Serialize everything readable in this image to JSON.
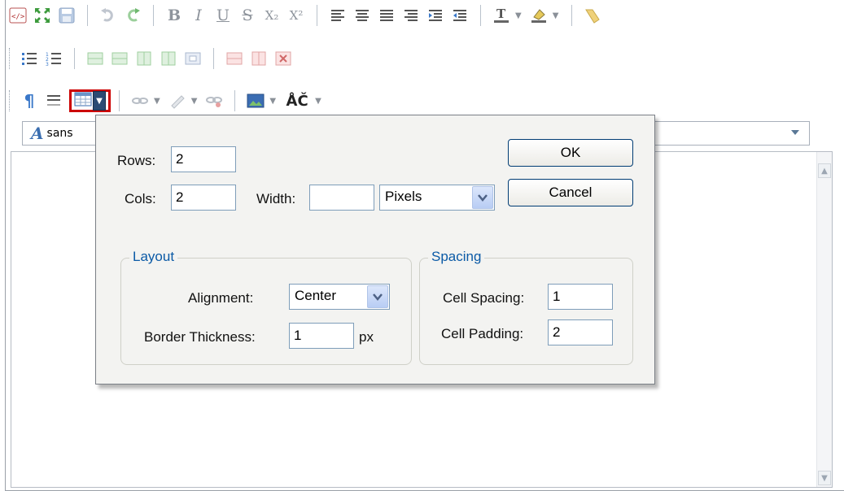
{
  "toolbar": {
    "row1": {
      "icons": [
        "html-source-icon",
        "fullscreen-icon",
        "save-icon",
        "undo-icon",
        "redo-icon"
      ],
      "bold": "B",
      "italic": "I",
      "underline": "U",
      "strike": "S",
      "subscript": "X₂",
      "superscript": "X²",
      "align_icons": [
        "align-left-icon",
        "align-center-icon",
        "align-right-icon",
        "align-justify-icon",
        "indent-icon",
        "outdent-icon"
      ],
      "text_color_icon": "text-color-icon",
      "bg_color_icon": "background-color-icon",
      "format_painter_icon": "format-painter-icon"
    },
    "row2": {
      "icons": [
        "bulleted-list-icon",
        "numbered-list-icon",
        "insert-row-above-icon",
        "insert-row-below-icon",
        "insert-col-left-icon",
        "insert-col-right-icon",
        "merge-cells-icon",
        "delete-row-icon",
        "delete-col-icon",
        "delete-table-icon"
      ]
    },
    "row3": {
      "pilcrow": "¶",
      "special_chars": "ÅČ",
      "icons": [
        "paragraph-icon",
        "horizontal-rule-icon",
        "insert-table-icon",
        "link-icon",
        "unlink-icon",
        "anchor-icon",
        "image-icon"
      ]
    },
    "font_name": "sans"
  },
  "dialog": {
    "rows_label": "Rows:",
    "rows_value": "2",
    "cols_label": "Cols:",
    "cols_value": "2",
    "width_label": "Width:",
    "width_value": "",
    "width_unit": "Pixels",
    "ok_label": "OK",
    "cancel_label": "Cancel",
    "layout": {
      "legend": "Layout",
      "alignment_label": "Alignment:",
      "alignment_value": "Center",
      "border_label": "Border Thickness:",
      "border_value": "1",
      "border_unit": "px"
    },
    "spacing": {
      "legend": "Spacing",
      "cell_spacing_label": "Cell Spacing:",
      "cell_spacing_value": "1",
      "cell_padding_label": "Cell Padding:",
      "cell_padding_value": "2"
    }
  },
  "colors": {
    "accent": "#0b5aa6",
    "highlight": "#cc0000",
    "dialog_bg": "#f3f3f1"
  }
}
